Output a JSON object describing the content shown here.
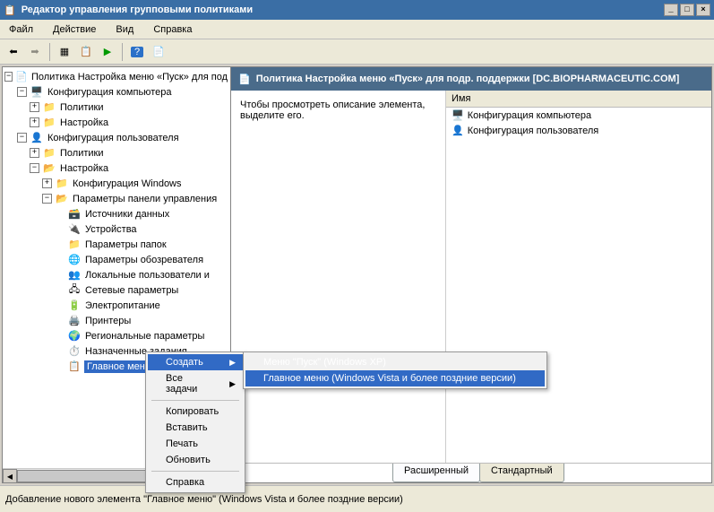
{
  "window": {
    "title": "Редактор управления групповыми политиками"
  },
  "menubar": {
    "file": "Файл",
    "action": "Действие",
    "view": "Вид",
    "help": "Справка"
  },
  "tree": {
    "root": "Политика Настройка меню «Пуск» для под",
    "cc": "Конфигурация компьютера",
    "pols": "Политики",
    "setts": "Настройка",
    "uc": "Конфигурация пользователя",
    "winconf": "Конфигурация Windows",
    "cp": "Параметры панели управления",
    "ds": "Источники данных",
    "dev": "Устройства",
    "fold": "Параметры папок",
    "browser": "Параметры обозревателя",
    "lusg": "Локальные пользователи и",
    "net": "Сетевые параметры",
    "power": "Электропитание",
    "printers": "Принтеры",
    "reg": "Региональные параметры",
    "sched": "Назначенные задания",
    "startmenu": "Главное меню"
  },
  "right": {
    "header": "Политика Настройка меню «Пуск» для подр. поддержки [DC.BIOPHARMACEUTIC.COM]",
    "desc": "Чтобы просмотреть описание элемента, выделите его.",
    "colName": "Имя",
    "item1": "Конфигурация компьютера",
    "item2": "Конфигурация пользователя"
  },
  "tabs": {
    "ext": "Расширенный",
    "std": "Стандартный"
  },
  "status": "Добавление нового элемента \"Главное меню\" (Windows Vista и более поздние версии)",
  "ctx": {
    "create": "Создать",
    "alltasks": "Все задачи",
    "copy": "Копировать",
    "paste": "Вставить",
    "print": "Печать",
    "refresh": "Обновить",
    "help": "Справка",
    "sub1": "Меню \"Пуск\" (Windows XP)",
    "sub2": "Главное меню (Windows Vista и более поздние версии)"
  }
}
